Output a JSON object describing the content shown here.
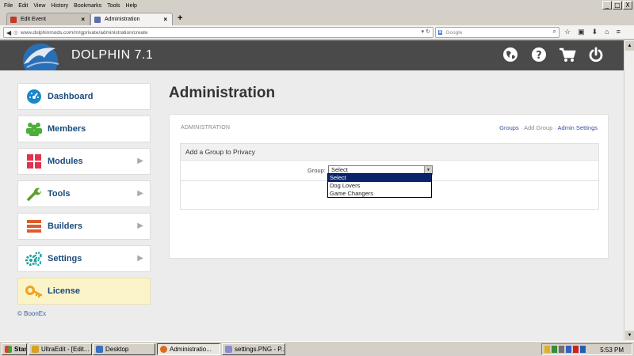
{
  "browser": {
    "menu": [
      "File",
      "Edit",
      "View",
      "History",
      "Bookmarks",
      "Tools",
      "Help"
    ],
    "tabs": [
      {
        "title": "Edit Event",
        "active": false
      },
      {
        "title": "Administration",
        "active": true
      }
    ],
    "new_tab": "+",
    "url": "www.dolphinmods.com/m/gprivate/administration/create",
    "search_placeholder": "Google",
    "window_buttons": [
      "_",
      "□",
      "X"
    ]
  },
  "site": {
    "brand": "DOLPHIN 7.1",
    "header_icons": [
      "globe-icon",
      "help-icon",
      "cart-icon",
      "power-icon"
    ],
    "sidebar": [
      {
        "label": "Dashboard",
        "icon": "dashboard-icon",
        "color": "#1a87c9",
        "arrow": false
      },
      {
        "label": "Members",
        "icon": "members-icon",
        "color": "#4cae3a",
        "arrow": false
      },
      {
        "label": "Modules",
        "icon": "modules-icon",
        "color": "#e0334d",
        "arrow": true
      },
      {
        "label": "Tools",
        "icon": "wrench-icon",
        "color": "#5aa02c",
        "arrow": true
      },
      {
        "label": "Builders",
        "icon": "builders-icon",
        "color": "#e05a2a",
        "arrow": true
      },
      {
        "label": "Settings",
        "icon": "gear-icon",
        "color": "#1aa0a0",
        "arrow": true
      },
      {
        "label": "License",
        "icon": "key-icon",
        "color": "#f0a020",
        "arrow": false
      }
    ],
    "copyright": "© BoonEx"
  },
  "main": {
    "title": "Administration",
    "panel_header": "ADMINISTRATION",
    "breadcrumbs": {
      "groups": "Groups",
      "sep1": " · ",
      "add_group": "Add Group",
      "sep2": " · ",
      "admin_settings": "Admin Settings"
    },
    "form": {
      "heading": "Add a Group to Privacy",
      "group_label": "Group:",
      "selected": "Select",
      "options": [
        "Select",
        "Dog Lovers",
        "Game Changers"
      ]
    }
  },
  "taskbar": {
    "start": "Start",
    "tasks": [
      {
        "label": "UltraEdit - [Edit...",
        "active": false
      },
      {
        "label": "Desktop",
        "active": false
      },
      {
        "label": "Administratio...",
        "active": true
      },
      {
        "label": "settings.PNG - P...",
        "active": false
      }
    ],
    "clock": "5:53 PM"
  }
}
